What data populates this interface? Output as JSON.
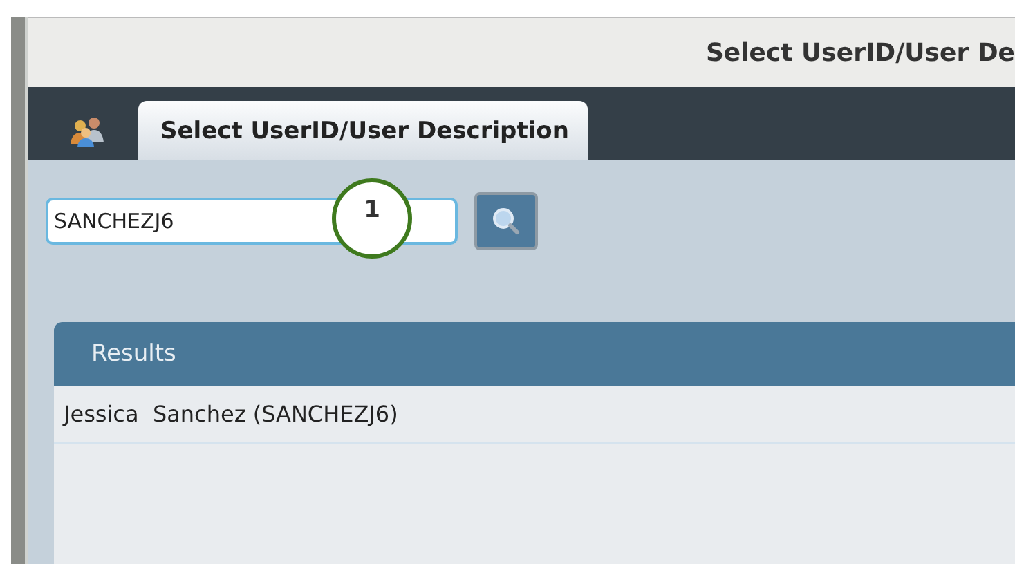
{
  "window": {
    "title": "Select UserID/User De"
  },
  "tabs": [
    {
      "kind": "icon",
      "selected": false
    },
    {
      "kind": "text",
      "label": "Select UserID/User Description",
      "selected": true
    }
  ],
  "search": {
    "value": "SANCHEZJ6"
  },
  "callout": {
    "label": "1"
  },
  "results": {
    "title": "Results",
    "rows": [
      "Jessica  Sanchez (SANCHEZJ6)"
    ]
  }
}
